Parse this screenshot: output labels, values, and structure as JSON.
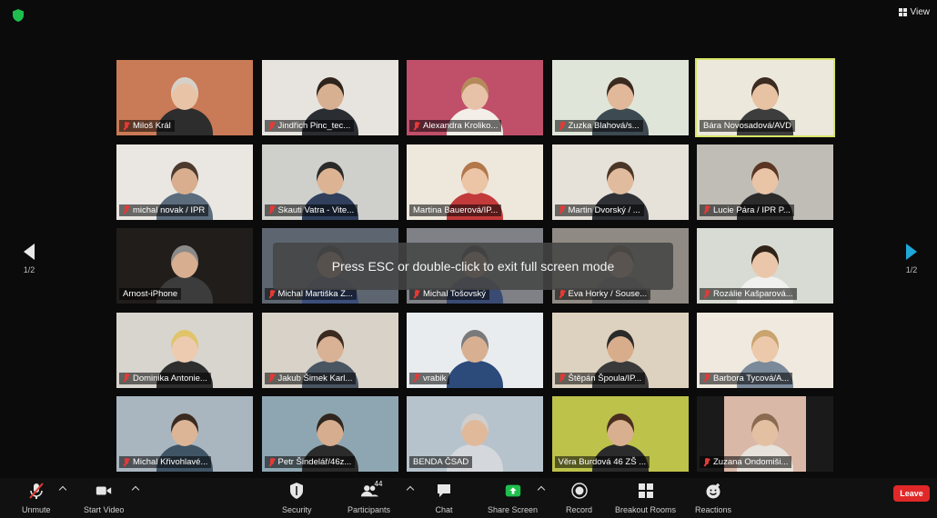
{
  "header": {
    "view_label": "View"
  },
  "gallery": {
    "tiles": [
      {
        "name": "Miloš Král",
        "muted": true,
        "bg": "#c97a56",
        "skin": "#e8c3a6",
        "hair": "#d6d0c8",
        "shirt": "#2d2d2d"
      },
      {
        "name": "Jindřich Pinc_tec...",
        "muted": true,
        "bg": "#e7e4df",
        "skin": "#d7b091",
        "hair": "#2f241c",
        "shirt": "#2a2e33"
      },
      {
        "name": "Alexandra Kroliko...",
        "muted": true,
        "bg": "#c04f6a",
        "skin": "#e8c2a8",
        "hair": "#b58a5a",
        "shirt": "#f3efe8"
      },
      {
        "name": "Zuzka Blahová/s...",
        "muted": true,
        "bg": "#dfe6d9",
        "skin": "#e1b899",
        "hair": "#3a2a20",
        "shirt": "#3e4a52"
      },
      {
        "name": "Bára Novosadová/AVD",
        "muted": false,
        "bg": "#ece8dc",
        "skin": "#e7c2a3",
        "hair": "#3b2b20",
        "shirt": "#3d3d3d",
        "active": true
      },
      {
        "name": "michal novak / IPR",
        "muted": true,
        "bg": "#eae7e2",
        "skin": "#d8ae8f",
        "hair": "#4b3a2d",
        "shirt": "#5b6c7d"
      },
      {
        "name": "Skauti Vatra - Vite...",
        "muted": true,
        "bg": "#cfcfcb",
        "skin": "#dcb494",
        "hair": "#2a2a2a",
        "shirt": "#2f3f5c"
      },
      {
        "name": "Martina Bauerová/IP...",
        "muted": false,
        "bg": "#eee7dc",
        "skin": "#ecc5a7",
        "hair": "#b2774a",
        "shirt": "#c33a3a"
      },
      {
        "name": "Martin Dvorský / ...",
        "muted": true,
        "bg": "#e6e2da",
        "skin": "#e1bb9d",
        "hair": "#4a3626",
        "shirt": "#2f3136"
      },
      {
        "name": "Lucie Pára / IPR P...",
        "muted": true,
        "bg": "#c0bdb6",
        "skin": "#e9c4a7",
        "hair": "#5a3523",
        "shirt": "#2b2b2b"
      },
      {
        "name": "Arnost-iPhone",
        "muted": false,
        "bg": "#201d1a",
        "skin": "#d8ae90",
        "hair": "#8a8a8a",
        "shirt": "#3c3c3c"
      },
      {
        "name": "Michal Martiška Z...",
        "muted": true,
        "bg": "#5d6670",
        "skin": "#d2a789",
        "hair": "#2a2a2a",
        "shirt": "#3b4f7a"
      },
      {
        "name": "Michal Tošovský",
        "muted": true,
        "bg": "#7f8187",
        "skin": "#d6ab8b",
        "hair": "#2f2f2f",
        "shirt": "#394a73"
      },
      {
        "name": "Eva Horky / Souse...",
        "muted": true,
        "bg": "#8f8a83",
        "skin": "#e2b898",
        "hair": "#6b4a33",
        "shirt": "#6a6a6a"
      },
      {
        "name": "Rozálie Kašparová...",
        "muted": true,
        "bg": "#d7dbd3",
        "skin": "#eac7ab",
        "hair": "#2f2218",
        "shirt": "#f0f0ee"
      },
      {
        "name": "Dominika Antonie...",
        "muted": true,
        "bg": "#d8d5cf",
        "skin": "#edcbb0",
        "hair": "#e0c46a",
        "shirt": "#2e2e2e"
      },
      {
        "name": "Jakub Šimek Karl...",
        "muted": true,
        "bg": "#d8d2c8",
        "skin": "#d9b194",
        "hair": "#3a2a20",
        "shirt": "#4a5562"
      },
      {
        "name": "vrabik",
        "muted": true,
        "bg": "#e9ecef",
        "skin": "#d8b091",
        "hair": "#7a7a7a",
        "shirt": "#2c4a7a"
      },
      {
        "name": "Štěpán Špoula/IP...",
        "muted": true,
        "bg": "#ddd2bf",
        "skin": "#d8ad8c",
        "hair": "#2a2a2a",
        "shirt": "#3a3a3a"
      },
      {
        "name": "Barbora Tycová/A...",
        "muted": true,
        "bg": "#efe9df",
        "skin": "#edc9ac",
        "hair": "#c9a46e",
        "shirt": "#7a8a9a"
      },
      {
        "name": "Michal Křivohlavé...",
        "muted": true,
        "bg": "#a9b6c0",
        "skin": "#dcb596",
        "hair": "#3a2b21",
        "shirt": "#3f5566"
      },
      {
        "name": "Petr Šindelář/46z...",
        "muted": true,
        "bg": "#8ea6b1",
        "skin": "#d6ad8f",
        "hair": "#2f2620",
        "shirt": "#2b2b2b"
      },
      {
        "name": "BENDA ČSAD",
        "muted": false,
        "bg": "#b7c3cc",
        "skin": "#e0b99b",
        "hair": "#cfcfcf",
        "shirt": "#d4d8dc"
      },
      {
        "name": "Věra Burdová 46 ZŠ ...",
        "muted": false,
        "bg": "#bcc24a",
        "skin": "#d9b08f",
        "hair": "#4a2e1e",
        "shirt": "#2b2b2b"
      },
      {
        "name": "Zuzana Ondomiši...",
        "muted": true,
        "bg": "#1a1a1a",
        "skin": "#e4c0a3",
        "hair": "#8a6a50",
        "shirt": "#e7e2db",
        "inset": true
      }
    ]
  },
  "nav": {
    "prev_page": "1/2",
    "next_page": "1/2"
  },
  "toast": {
    "message": "Press ESC or double-click to exit full screen mode"
  },
  "toolbar": {
    "mute_label": "Unmute",
    "video_label": "Start Video",
    "security_label": "Security",
    "participants_label": "Participants",
    "participants_count": "44",
    "chat_label": "Chat",
    "share_label": "Share Screen",
    "record_label": "Record",
    "breakout_label": "Breakout Rooms",
    "reactions_label": "Reactions",
    "leave_label": "Leave",
    "share_color": "#1fbf4d",
    "leave_color": "#e02828"
  }
}
